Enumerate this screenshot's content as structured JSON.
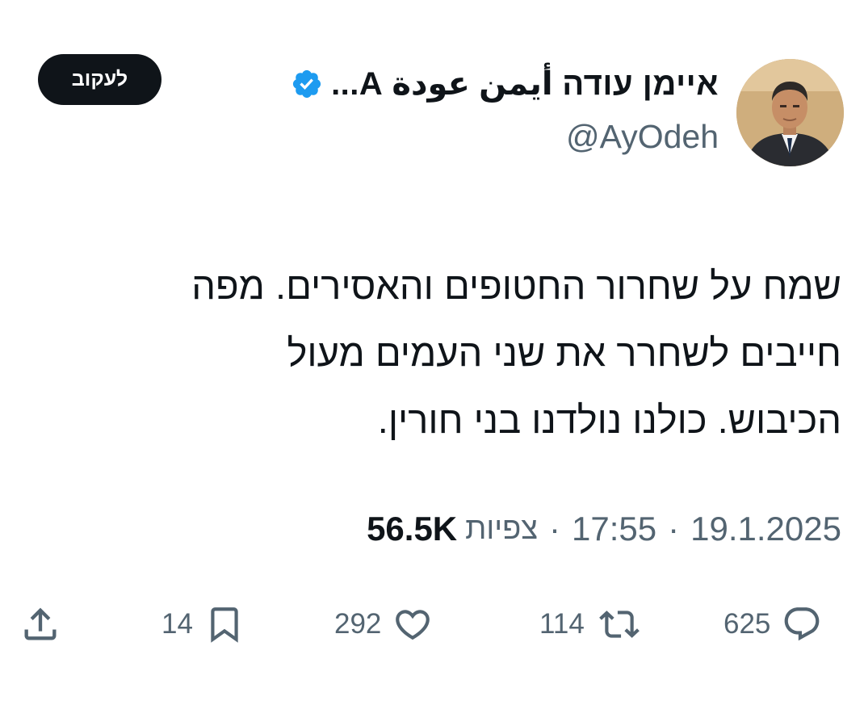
{
  "author": {
    "display_name": "איימן עודה أيمن عودة A...",
    "handle": "@AyOdeh",
    "verified_icon": "verified-badge-icon",
    "badge_color": "#1d9bf0"
  },
  "follow_button": {
    "label": "לעקוב"
  },
  "tweet": {
    "lines": [
      "שמח על שחרור החטופים והאסירים. מפה",
      "חייבים לשחרר את שני העמים מעול",
      "הכיבוש. כולנו נולדנו בני חורין."
    ]
  },
  "meta": {
    "date": "19.1.2025",
    "time": "17:55",
    "separator": "·",
    "views_label": "צפיות",
    "views_count": "56.5K"
  },
  "actions": {
    "reply": {
      "count": "625",
      "icon": "reply-icon"
    },
    "retweet": {
      "count": "114",
      "icon": "retweet-icon"
    },
    "like": {
      "count": "292",
      "icon": "heart-icon"
    },
    "bookmark": {
      "count": "14",
      "icon": "bookmark-icon"
    },
    "share": {
      "icon": "share-icon"
    }
  },
  "colors": {
    "text": "#0f1419",
    "secondary": "#536471",
    "verified": "#1d9bf0",
    "button_bg": "#0f1419"
  }
}
